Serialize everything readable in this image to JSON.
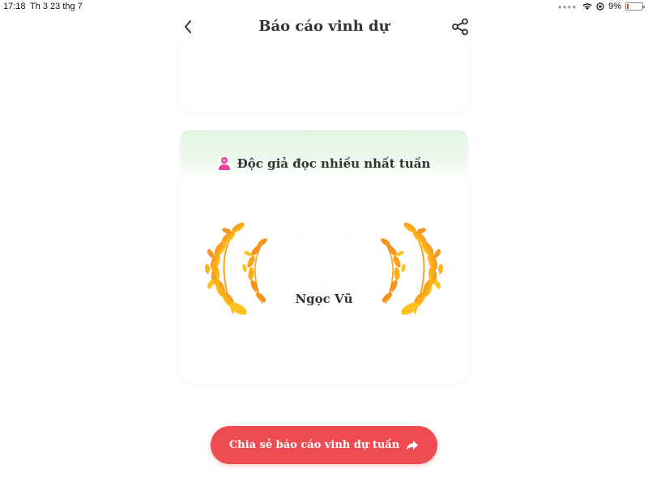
{
  "status_bar": {
    "time": "17:18",
    "date": "Th 3 23 thg 7",
    "battery": "9%",
    "icons": [
      "signal-dots-icon",
      "wifi-icon",
      "orientation-lock-icon",
      "battery-icon"
    ]
  },
  "header": {
    "title": "Báo cáo vinh dự",
    "back_icon": "chevron-left-icon",
    "share_icon": "share-icon"
  },
  "reader_card": {
    "heading": "Độc giả đọc nhiều nhất tuần",
    "heading_icon": "user-icon",
    "name": "Ngọc Vũ",
    "decoration": "laurel-wreath"
  },
  "share_button": {
    "label": "Chia sẻ báo cáo vinh dự tuần",
    "icon": "forward-arrow-icon"
  },
  "colors": {
    "accent": "#ee4b52",
    "card_header": "#dff4df",
    "laurel_light": "#ffc21a",
    "laurel_dark": "#f7941d",
    "user_icon": "#e8439b"
  }
}
